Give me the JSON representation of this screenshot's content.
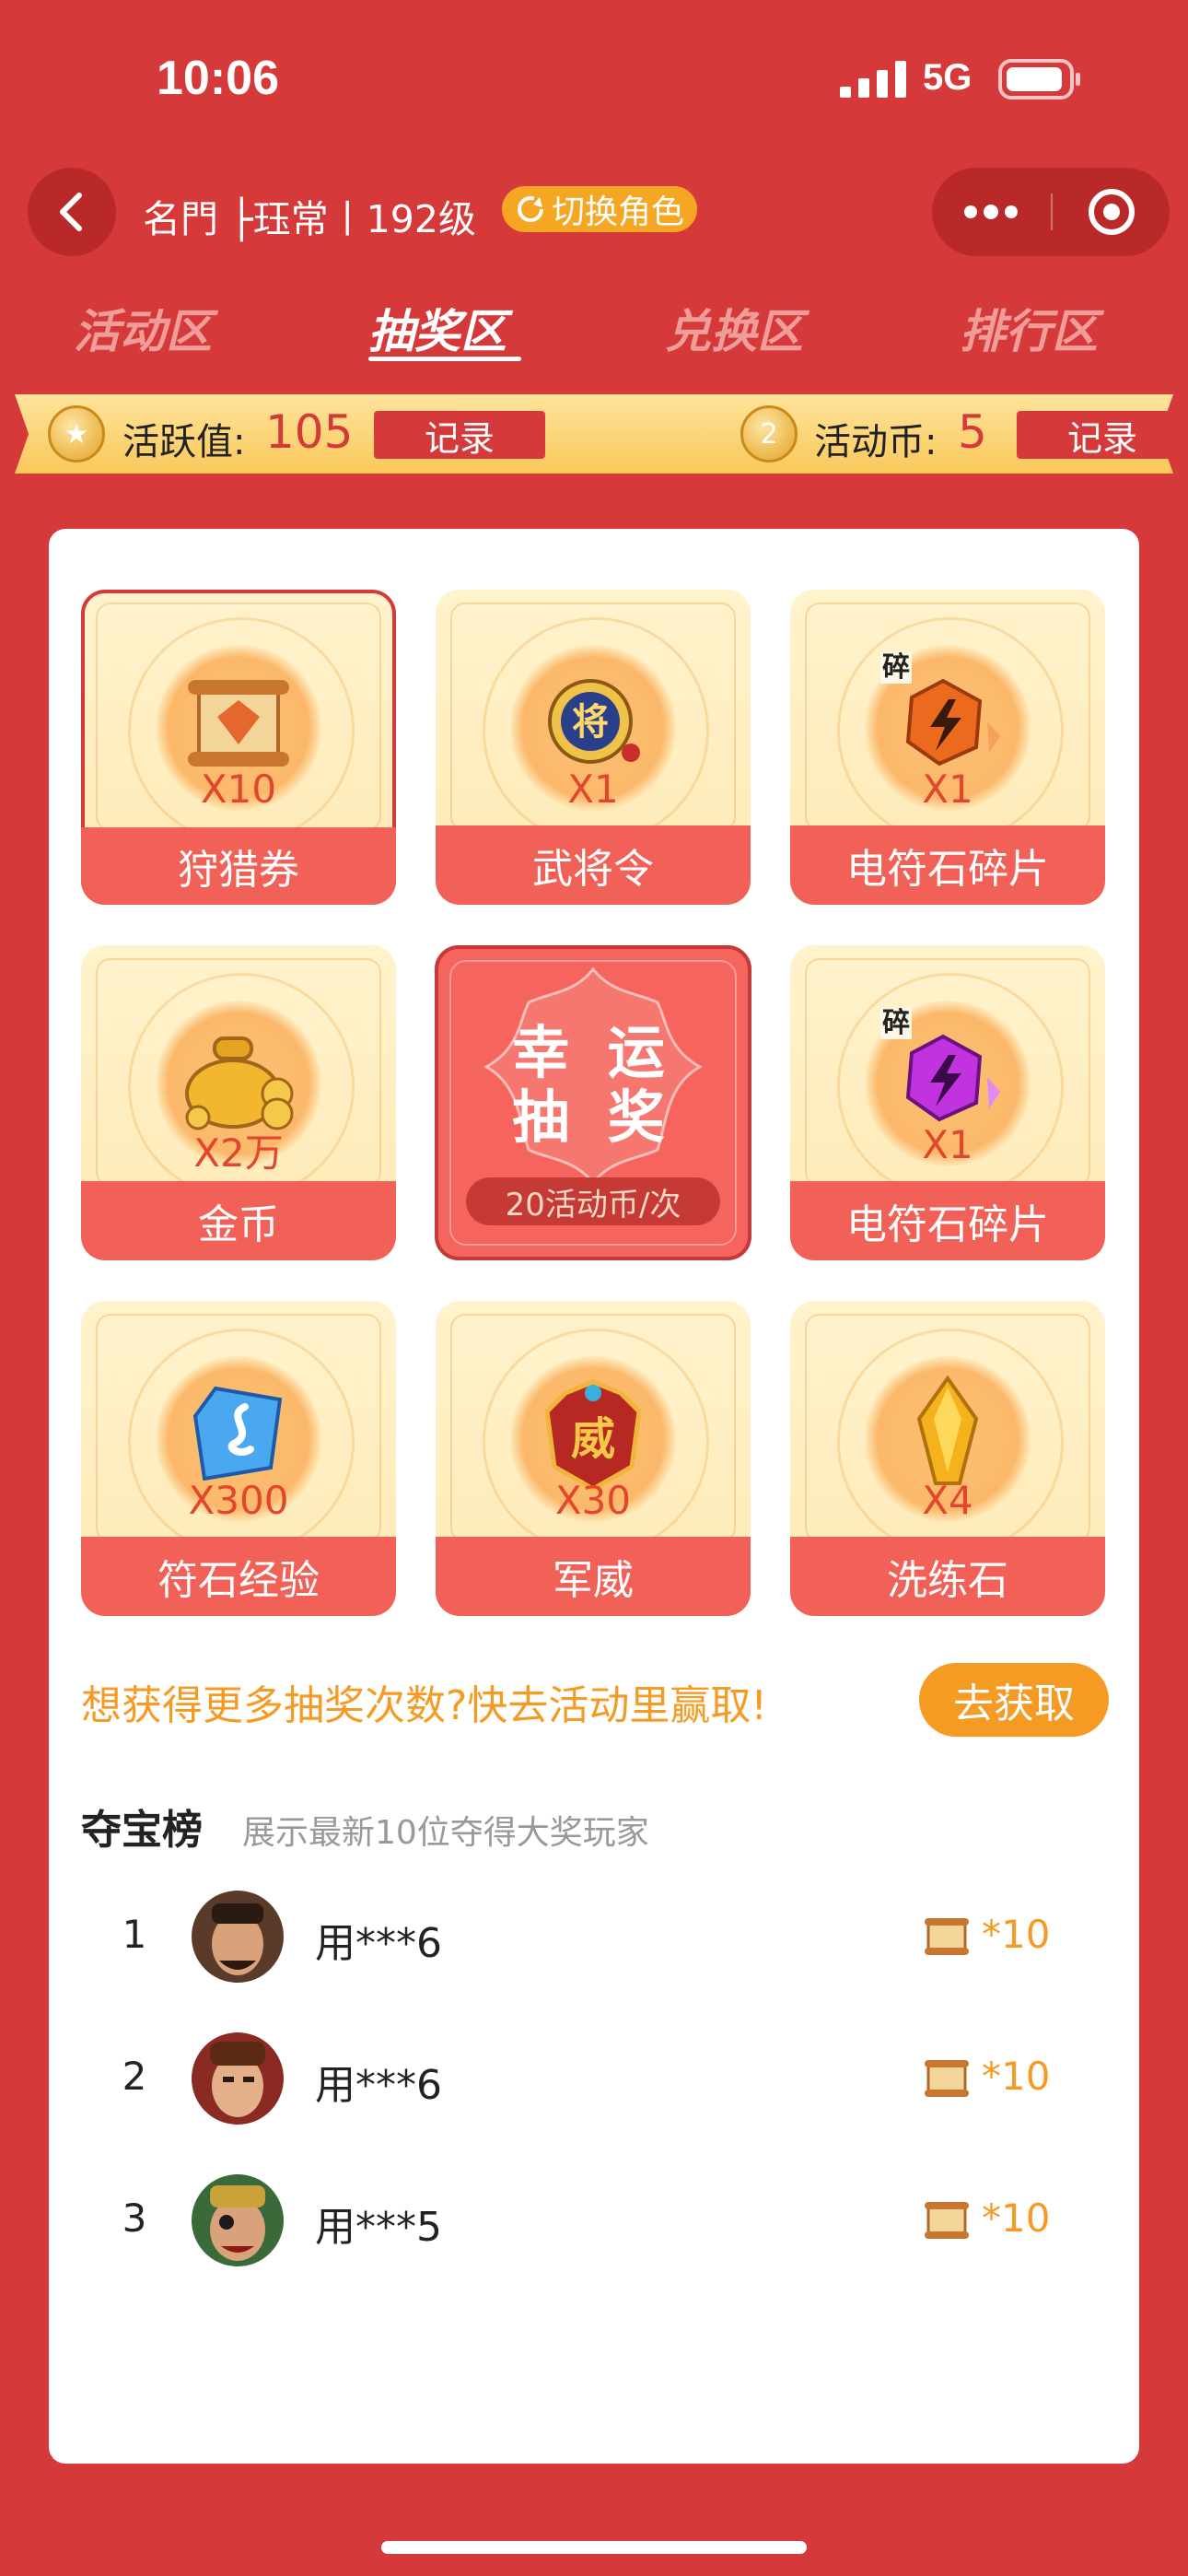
{
  "status_bar": {
    "time": "10:06",
    "network": "5G"
  },
  "header": {
    "title": "名門 ├珏常丨192级",
    "switch_role": "切换角色"
  },
  "tabs": [
    {
      "label": "活动区",
      "active": false
    },
    {
      "label": "抽奖区",
      "active": true
    },
    {
      "label": "兑换区",
      "active": false
    },
    {
      "label": "排行区",
      "active": false
    }
  ],
  "ribbon": {
    "activity_label": "活跃值:",
    "activity_value": "105",
    "activity_record": "记录",
    "coin_label": "活动币:",
    "coin_value": "5",
    "coin_record": "记录"
  },
  "prizes": [
    {
      "name": "狩猎券",
      "qty": "X10",
      "icon": "scroll-icon",
      "selected": true
    },
    {
      "name": "武将令",
      "qty": "X1",
      "icon": "general-token-icon"
    },
    {
      "name": "电符石碎片",
      "qty": "X1",
      "icon": "orange-rune-shard-icon",
      "fragment": "碎"
    },
    {
      "name": "金币",
      "qty": "X2万",
      "icon": "gold-coins-bag-icon"
    },
    {
      "name": "电符石碎片",
      "qty": "X1",
      "icon": "purple-rune-shard-icon",
      "fragment": "碎"
    },
    {
      "name": "符石经验",
      "qty": "X300",
      "icon": "blue-crystal-icon"
    },
    {
      "name": "军威",
      "qty": "X30",
      "icon": "military-badge-icon"
    },
    {
      "name": "洗练石",
      "qty": "X4",
      "icon": "yellow-gem-icon"
    }
  ],
  "lucky_draw": {
    "line1": "幸 运",
    "line2": "抽 奖",
    "cost": "20活动币/次"
  },
  "promo": {
    "text": "想获得更多抽奖次数?快去活动里赢取!",
    "button": "去获取"
  },
  "leaderboard": {
    "title": "夺宝榜",
    "subtitle": "展示最新10位夺得大奖玩家",
    "rows": [
      {
        "rank": "1",
        "player": "用***6",
        "reward": "*10"
      },
      {
        "rank": "2",
        "player": "用***6",
        "reward": "*10"
      },
      {
        "rank": "3",
        "player": "用***5",
        "reward": "*10"
      }
    ]
  },
  "colors": {
    "theme_red": "#d6393a",
    "accent_orange": "#f59a23",
    "ribbon_gold": "#f9c85a"
  }
}
